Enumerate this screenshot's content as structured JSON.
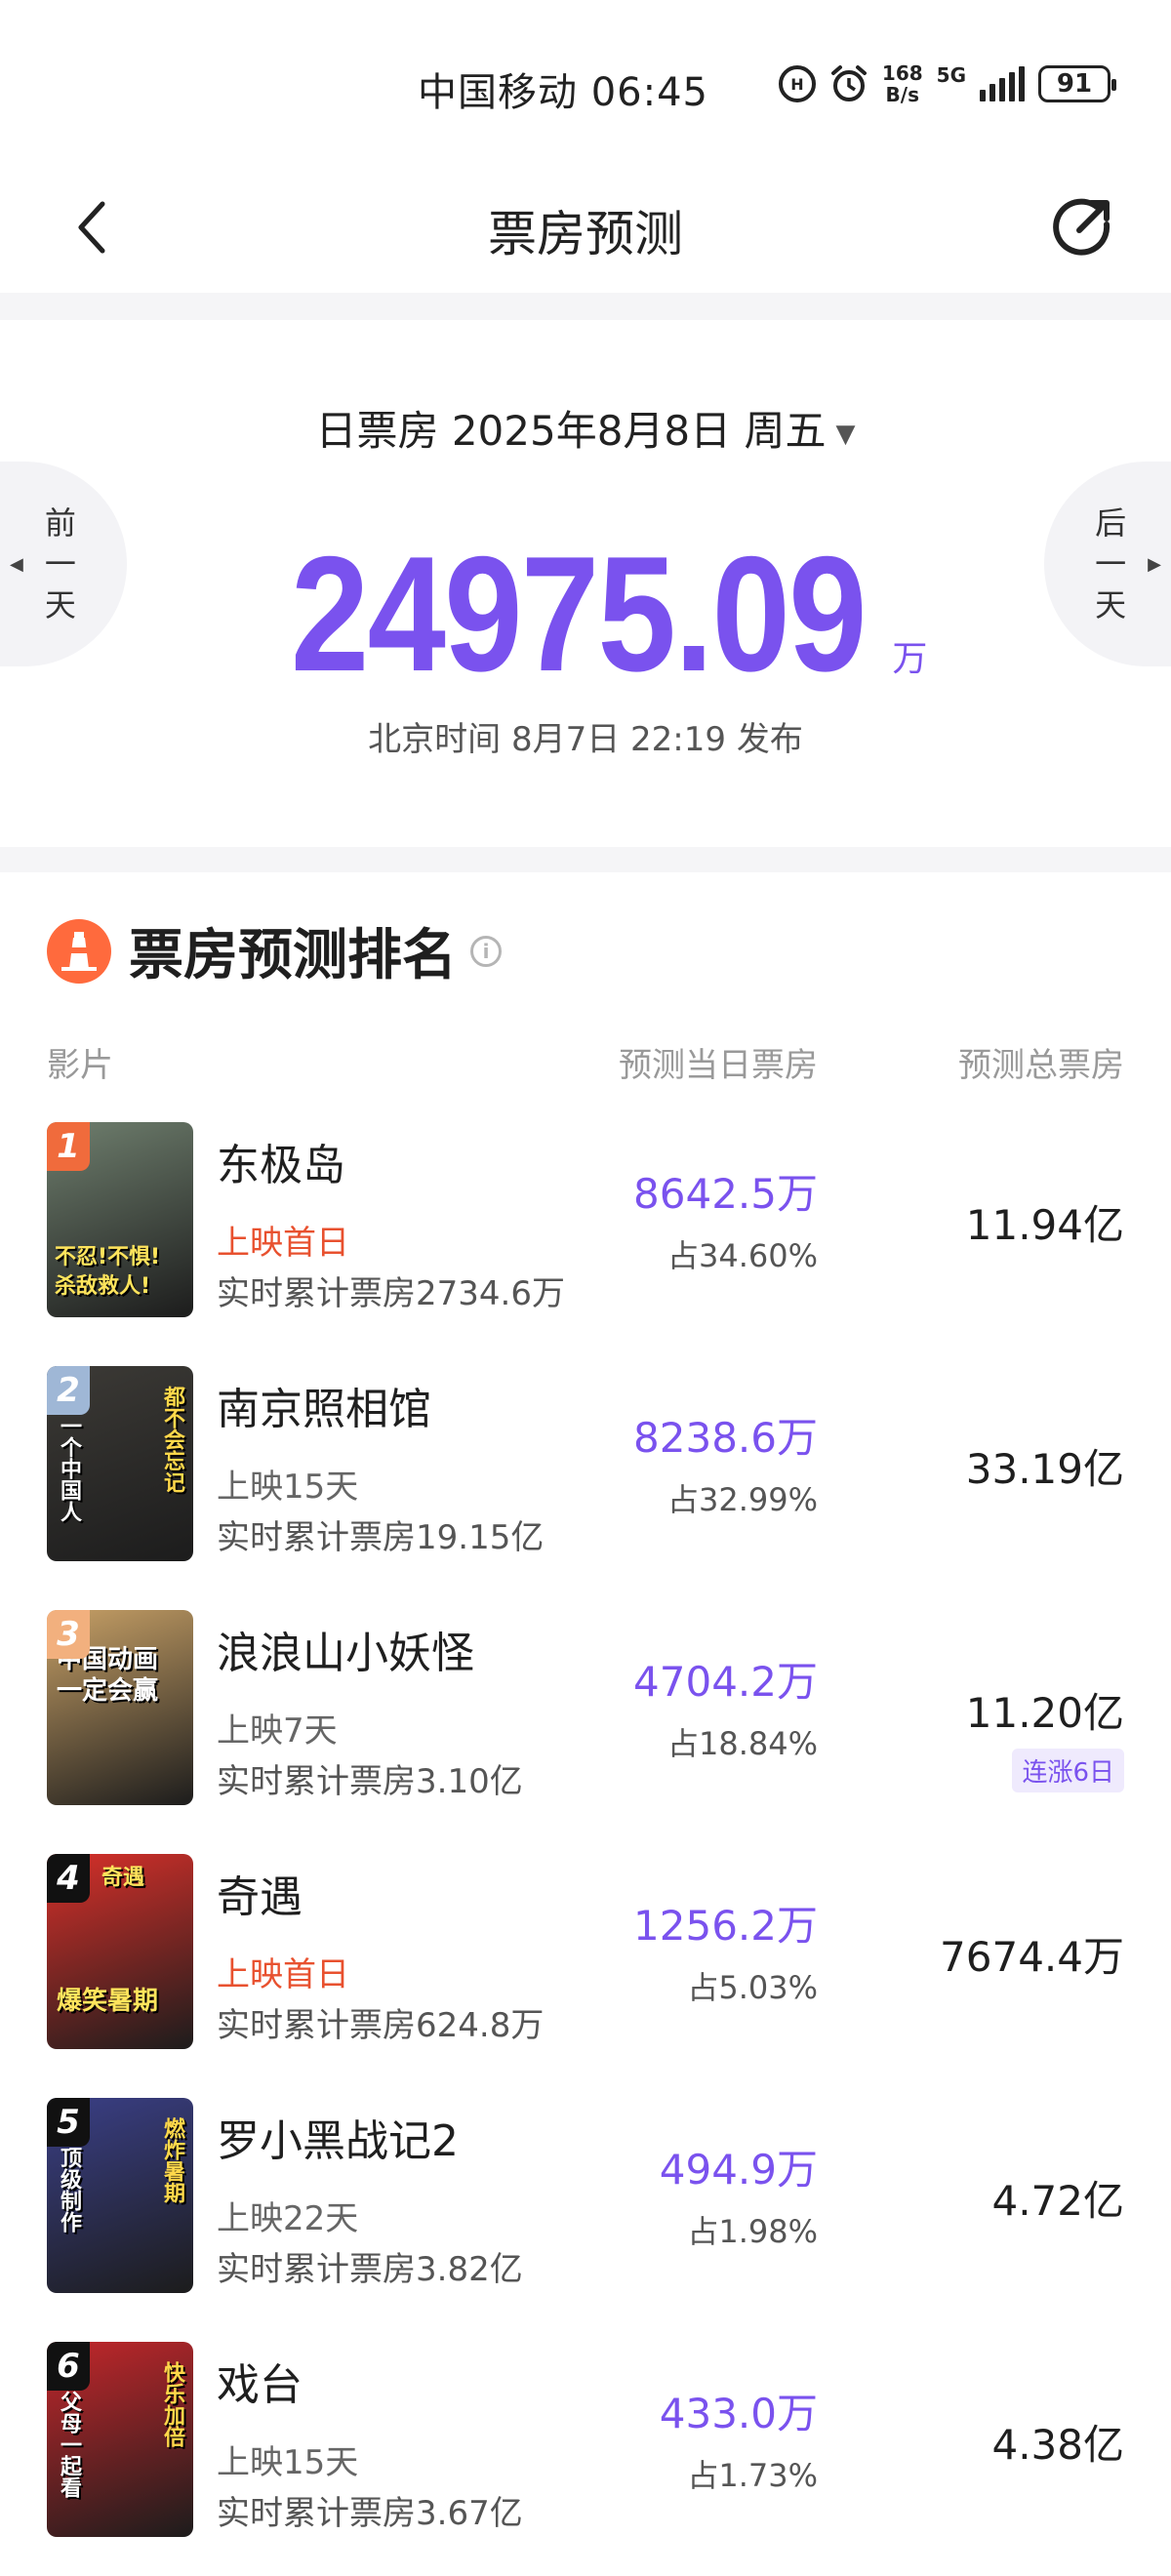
{
  "status_bar": {
    "carrier_time": "中国移动 06:45",
    "net_speed_top": "168",
    "net_speed_bottom": "B/s",
    "network": "5G",
    "battery": "91"
  },
  "nav": {
    "title": "票房预测"
  },
  "summary": {
    "date_label": "日票房 2025年8月8日 周五",
    "prev_label": [
      "前",
      "一",
      "天"
    ],
    "next_label": [
      "后",
      "一",
      "天"
    ],
    "value": "24975.09",
    "unit": "万",
    "publish": "北京时间 8月7日 22:19 发布"
  },
  "ranking": {
    "title": "票房预测排名",
    "columns": {
      "film": "影片",
      "day": "预测当日票房",
      "total": "预测总票房"
    },
    "movies": [
      {
        "rank": "1",
        "title": "东极岛",
        "status": "上映首日",
        "first_day": true,
        "cumulative": "实时累计票房2734.6万",
        "day_forecast": "8642.5万",
        "share": "占34.60%",
        "total": "11.94亿",
        "tag": "",
        "poster_text": [
          "不忍!不惧!",
          "杀敌救人!"
        ],
        "badge_color": "#f06b3c",
        "poster_bg": "#6f7f6e"
      },
      {
        "rank": "2",
        "title": "南京照相馆",
        "status": "上映15天",
        "first_day": false,
        "cumulative": "实时累计票房19.15亿",
        "day_forecast": "8238.6万",
        "share": "占32.99%",
        "total": "33.19亿",
        "tag": "",
        "poster_text": [
          "一个中国人",
          "都不会忘记"
        ],
        "badge_color": "#9fb7d6",
        "poster_bg": "#3c3a36"
      },
      {
        "rank": "3",
        "title": "浪浪山小妖怪",
        "status": "上映7天",
        "first_day": false,
        "cumulative": "实时累计票房3.10亿",
        "day_forecast": "4704.2万",
        "share": "占18.84%",
        "total": "11.20亿",
        "tag": "连涨6日",
        "poster_text": [
          "中国动画",
          "一定会赢"
        ],
        "badge_color": "#f2b07e",
        "poster_bg": "#c7a066"
      },
      {
        "rank": "4",
        "title": "奇遇",
        "status": "上映首日",
        "first_day": true,
        "cumulative": "实时累计票房624.8万",
        "day_forecast": "1256.2万",
        "share": "占5.03%",
        "total": "7674.4万",
        "tag": "",
        "poster_text": [
          "奇遇",
          "爆笑暑期"
        ],
        "badge_color": "#111111",
        "poster_bg": "#d8302a"
      },
      {
        "rank": "5",
        "title": "罗小黑战记2",
        "status": "上映22天",
        "first_day": false,
        "cumulative": "实时累计票房3.82亿",
        "day_forecast": "494.9万",
        "share": "占1.98%",
        "total": "4.72亿",
        "tag": "",
        "poster_text": [
          "顶级制作",
          "燃炸暑期"
        ],
        "badge_color": "#111111",
        "poster_bg": "#3a3f86"
      },
      {
        "rank": "6",
        "title": "戏台",
        "status": "上映15天",
        "first_day": false,
        "cumulative": "实时累计票房3.67亿",
        "day_forecast": "433.0万",
        "share": "占1.73%",
        "total": "4.38亿",
        "tag": "",
        "poster_text": [
          "父母一起看",
          "快乐加倍"
        ],
        "badge_color": "#111111",
        "poster_bg": "#c3272b"
      }
    ]
  },
  "colors": {
    "accent": "#7a52ee",
    "first_day": "#e8512f",
    "logo": "#ff6a3d"
  }
}
